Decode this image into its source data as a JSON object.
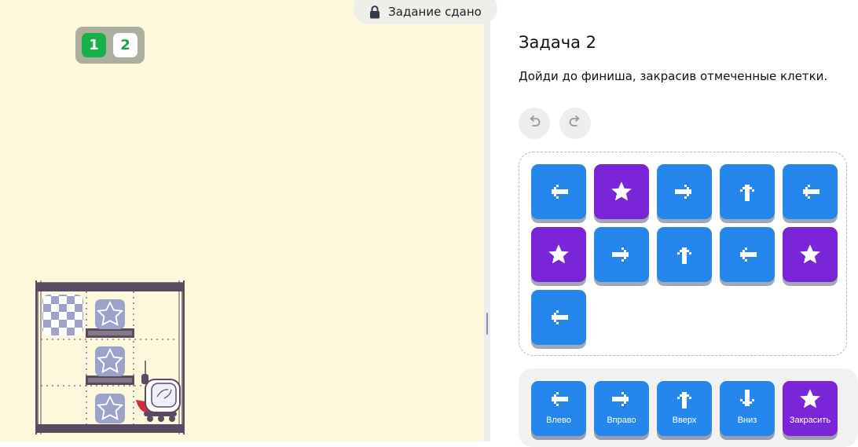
{
  "status": {
    "label": "Задание сдано",
    "icon": "lock-icon"
  },
  "levels": [
    {
      "label": "1",
      "state": "current"
    },
    {
      "label": "2",
      "state": "available"
    }
  ],
  "task": {
    "title": "Задача 2",
    "description": "Дойди до финиша, закрасив отмеченные клетки."
  },
  "history": {
    "undo_icon": "undo-icon",
    "redo_icon": "redo-icon"
  },
  "program": [
    "left",
    "paint",
    "right",
    "up",
    "left",
    "paint",
    "right",
    "up",
    "left",
    "paint",
    "left"
  ],
  "palette": [
    {
      "command": "left",
      "label": "Влево"
    },
    {
      "command": "right",
      "label": "Вправо"
    },
    {
      "command": "up",
      "label": "Вверх"
    },
    {
      "command": "down",
      "label": "Вниз"
    },
    {
      "command": "paint",
      "label": "Закрасить"
    }
  ],
  "colors": {
    "move_block": "#2587ee",
    "paint_block": "#7a26d8",
    "level_current": "#19b04a",
    "field_background": "#fdf8dc"
  },
  "board": {
    "columns": 3,
    "rows": 3,
    "finish_cell": {
      "row": 1,
      "col": 1,
      "icon": "checkered-flag-icon"
    },
    "marked_cells": [
      {
        "row": 1,
        "col": 2,
        "icon": "star-icon"
      },
      {
        "row": 2,
        "col": 2,
        "icon": "star-icon"
      },
      {
        "row": 3,
        "col": 2,
        "icon": "star-icon"
      }
    ],
    "robot": {
      "row": 3,
      "col": 3,
      "icon": "robot-icon"
    }
  }
}
